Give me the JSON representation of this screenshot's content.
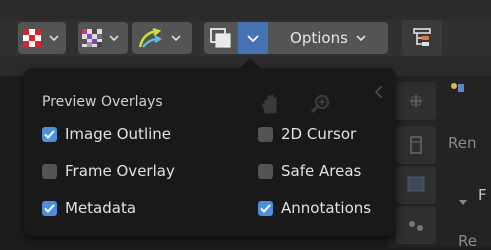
{
  "toolbar": {
    "options_label": "Options"
  },
  "popup": {
    "title": "Preview Overlays",
    "left_items": [
      {
        "label": "Image Outline",
        "checked": true
      },
      {
        "label": "Frame Overlay",
        "checked": false
      },
      {
        "label": "Metadata",
        "checked": true
      }
    ],
    "right_items": [
      {
        "label": "2D Cursor",
        "checked": false
      },
      {
        "label": "Safe Areas",
        "checked": false
      },
      {
        "label": "Annotations",
        "checked": true
      }
    ]
  },
  "background": {
    "text_1": "Ren",
    "text_2": "F",
    "text_3": "Re"
  },
  "colors": {
    "accent": "#4772b3",
    "checkbox_on": "#4d8fdc",
    "popup_bg": "#191919"
  }
}
